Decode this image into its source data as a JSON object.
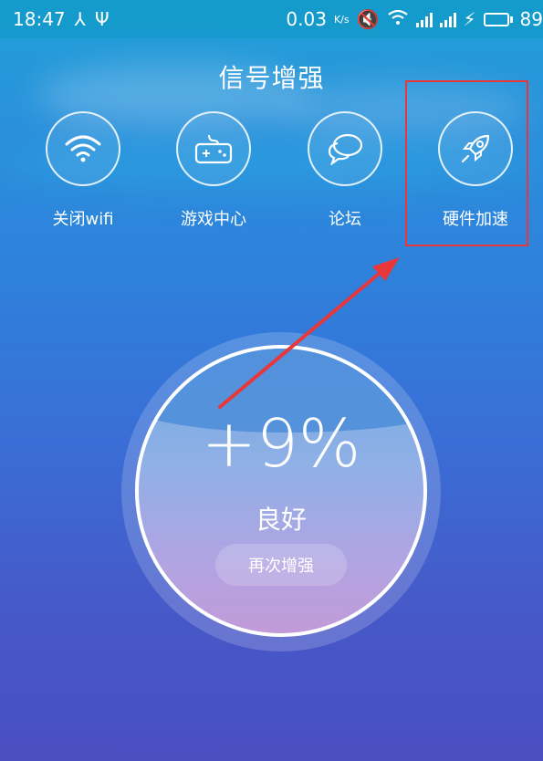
{
  "status_bar": {
    "time": "18:47",
    "speed": "0.03",
    "speed_unit": "K/s",
    "battery_text": "89",
    "battery_color": "#3bd24a"
  },
  "header": {
    "title": "信号增强"
  },
  "tools": [
    {
      "label": "关闭wifi",
      "icon": "wifi-icon"
    },
    {
      "label": "游戏中心",
      "icon": "gamepad-icon"
    },
    {
      "label": "论坛",
      "icon": "chat-bubbles-icon"
    },
    {
      "label": "硬件加速",
      "icon": "rocket-icon"
    }
  ],
  "gauge": {
    "value": "+9%",
    "status": "良好",
    "button_label": "再次增强"
  },
  "annotation": {
    "box_color": "#e8373b",
    "arrow_color": "#e8373b"
  }
}
